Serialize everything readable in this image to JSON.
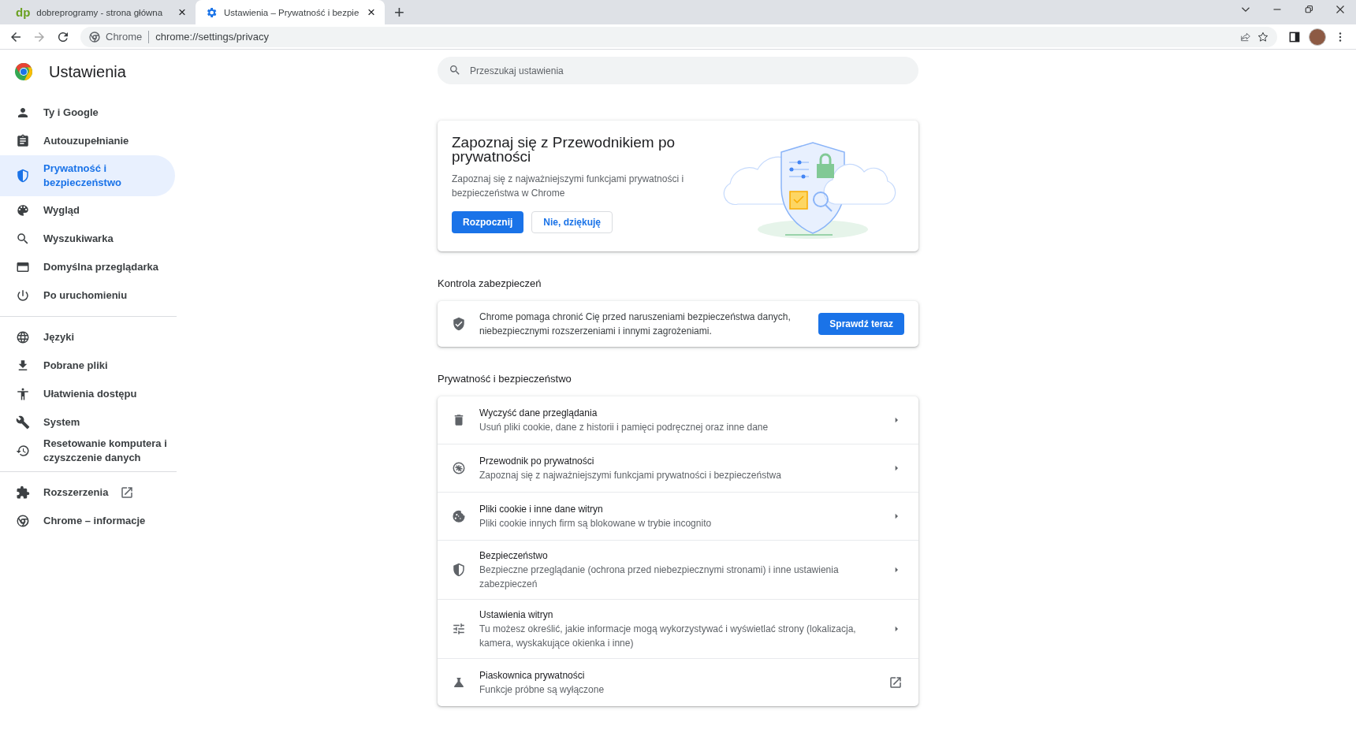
{
  "tabs": [
    {
      "kind": "text",
      "favicon_text": "dp",
      "title": "dobreprogramy - strona główna",
      "close": "×",
      "selected": false
    },
    {
      "kind": "gear",
      "title": "Ustawienia – Prywatność i bezpie",
      "close": "×",
      "selected": true
    }
  ],
  "new_tab": "+",
  "omnibox": {
    "chip": "Chrome",
    "url": "chrome://settings/privacy"
  },
  "sidebar": {
    "title": "Ustawienia",
    "groups": [
      [
        {
          "label": "Ty i Google",
          "kind": "person",
          "selected": false
        },
        {
          "label": "Autouzupełnianie",
          "kind": "clipboard",
          "selected": false
        },
        {
          "label": "Prywatność i bezpieczeństwo",
          "kind": "shield",
          "selected": true
        },
        {
          "label": "Wygląd",
          "kind": "palette",
          "selected": false
        },
        {
          "label": "Wyszukiwarka",
          "kind": "search",
          "selected": false
        },
        {
          "label": "Domyślna przeglądarka",
          "kind": "browser",
          "selected": false
        },
        {
          "label": "Po uruchomieniu",
          "kind": "power",
          "selected": false
        }
      ],
      [
        {
          "label": "Języki",
          "kind": "globe",
          "selected": false
        },
        {
          "label": "Pobrane pliki",
          "kind": "download",
          "selected": false
        },
        {
          "label": "Ułatwienia dostępu",
          "kind": "accessibility",
          "selected": false
        },
        {
          "label": "System",
          "kind": "wrench",
          "selected": false
        },
        {
          "label": "Resetowanie komputera i czyszczenie danych",
          "kind": "history",
          "selected": false
        }
      ],
      [
        {
          "label": "Rozszerzenia",
          "kind": "puzzle",
          "external": true,
          "selected": false
        },
        {
          "label": "Chrome – informacje",
          "kind": "chrome",
          "selected": false
        }
      ]
    ]
  },
  "search": {
    "placeholder": "Przeszukaj ustawienia"
  },
  "promo": {
    "title": "Zapoznaj się z Przewodnikiem po prywatności",
    "text": "Zapoznaj się z najważniejszymi funkcjami prywatności i bezpieczeństwa w Chrome",
    "primary": "Rozpocznij",
    "secondary": "Nie, dziękuję"
  },
  "safety_check": {
    "heading": "Kontrola zabezpieczeń",
    "text": "Chrome pomaga chronić Cię przed naruszeniami bezpieczeństwa danych, niebezpiecznymi rozszerzeniami i innymi zagrożeniami.",
    "button": "Sprawdź teraz"
  },
  "privacy": {
    "heading": "Prywatność i bezpieczeństwo",
    "rows": [
      {
        "kind": "trash",
        "title": "Wyczyść dane przeglądania",
        "subtitle": "Usuń pliki cookie, dane z historii i pamięci podręcznej oraz inne dane",
        "external": false
      },
      {
        "kind": "compass",
        "title": "Przewodnik po prywatności",
        "subtitle": "Zapoznaj się z najważniejszymi funkcjami prywatności i bezpieczeństwa",
        "external": false
      },
      {
        "kind": "cookie",
        "title": "Pliki cookie i inne dane witryn",
        "subtitle": "Pliki cookie innych firm są blokowane w trybie incognito",
        "external": false
      },
      {
        "kind": "shield",
        "title": "Bezpieczeństwo",
        "subtitle": "Bezpieczne przeglądanie (ochrona przed niebezpiecznymi stronami) i inne ustawienia zabezpieczeń",
        "external": false
      },
      {
        "kind": "tune",
        "title": "Ustawienia witryn",
        "subtitle": "Tu możesz określić, jakie informacje mogą wykorzystywać i wyświetlać strony (lokalizacja, kamera, wyskakujące okienka i inne)",
        "external": false
      },
      {
        "kind": "flask",
        "title": "Piaskownica prywatności",
        "subtitle": "Funkcje próbne są wyłączone",
        "external": true
      }
    ]
  }
}
